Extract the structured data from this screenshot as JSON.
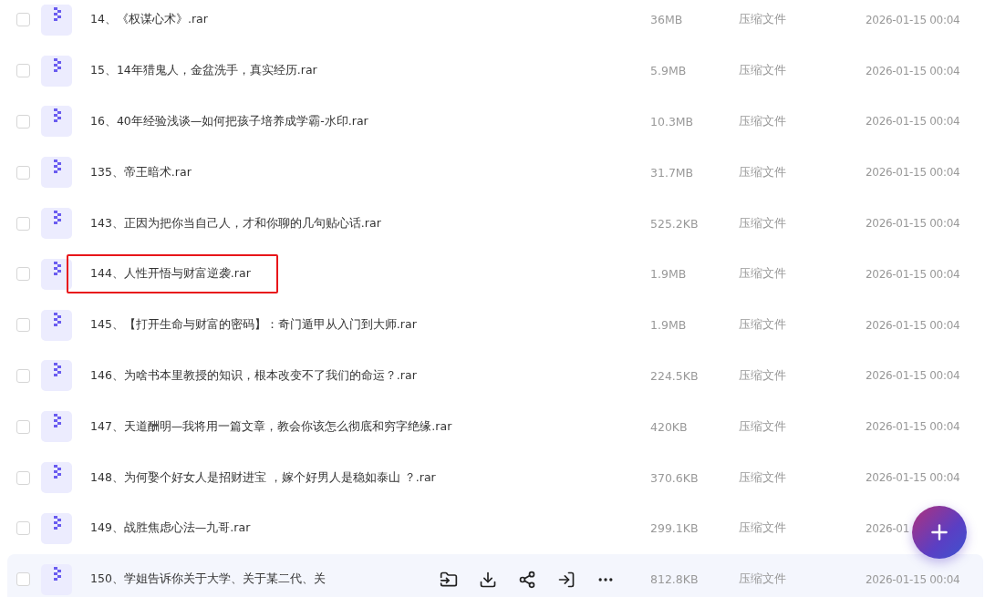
{
  "files": [
    {
      "name": "14、《权谋心术》.rar",
      "size": "36MB",
      "type": "压缩文件",
      "date": "2026-01-15 00:04",
      "checked": false,
      "highlighted": false,
      "hovered": false
    },
    {
      "name": "15、14年猎鬼人，金盆洗手，真实经历.rar",
      "size": "5.9MB",
      "type": "压缩文件",
      "date": "2026-01-15 00:04",
      "checked": false,
      "highlighted": false,
      "hovered": false
    },
    {
      "name": "16、40年经验浅谈—如何把孩子培养成学霸-水印.rar",
      "size": "10.3MB",
      "type": "压缩文件",
      "date": "2026-01-15 00:04",
      "checked": false,
      "highlighted": false,
      "hovered": false
    },
    {
      "name": "135、帝王暗术.rar",
      "size": "31.7MB",
      "type": "压缩文件",
      "date": "2026-01-15 00:04",
      "checked": false,
      "highlighted": false,
      "hovered": false
    },
    {
      "name": "143、正因为把你当自己人，才和你聊的几句贴心话.rar",
      "size": "525.2KB",
      "type": "压缩文件",
      "date": "2026-01-15 00:04",
      "checked": false,
      "highlighted": false,
      "hovered": false
    },
    {
      "name": "144、人性开悟与财富逆袭.rar",
      "size": "1.9MB",
      "type": "压缩文件",
      "date": "2026-01-15 00:04",
      "checked": false,
      "highlighted": true,
      "hovered": false
    },
    {
      "name": "145、【打开生命与财富的密码】：奇门遁甲从入门到大师.rar",
      "size": "1.9MB",
      "type": "压缩文件",
      "date": "2026-01-15 00:04",
      "checked": false,
      "highlighted": false,
      "hovered": false
    },
    {
      "name": "146、为啥书本里教授的知识，根本改变不了我们的命运？.rar",
      "size": "224.5KB",
      "type": "压缩文件",
      "date": "2026-01-15 00:04",
      "checked": false,
      "highlighted": false,
      "hovered": false
    },
    {
      "name": "147、天道酬明—我将用一篇文章，教会你该怎么彻底和穷字绝缘.rar",
      "size": "420KB",
      "type": "压缩文件",
      "date": "2026-01-15 00:04",
      "checked": false,
      "highlighted": false,
      "hovered": false
    },
    {
      "name": "148、为何娶个好女人是招财进宝 ，嫁个好男人是稳如泰山 ？.rar",
      "size": "370.6KB",
      "type": "压缩文件",
      "date": "2026-01-15 00:04",
      "checked": false,
      "highlighted": false,
      "hovered": false
    },
    {
      "name": "149、战胜焦虑心法—九哥.rar",
      "size": "299.1KB",
      "type": "压缩文件",
      "date": "2026-01",
      "checked": false,
      "highlighted": false,
      "hovered": false
    },
    {
      "name": "150、学姐告诉你关于大学、关于某二代、关",
      "size": "812.8KB",
      "type": "压缩文件",
      "date": "2026-01-15 00:04",
      "checked": false,
      "highlighted": false,
      "hovered": true
    }
  ]
}
